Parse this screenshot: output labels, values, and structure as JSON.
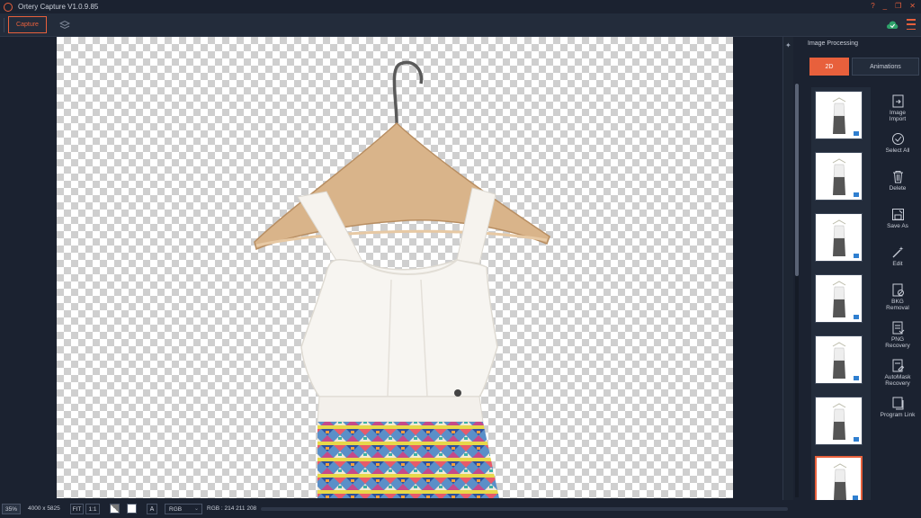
{
  "app": {
    "title": "Ortery Capture V1.0.9.85",
    "window_controls": [
      "?",
      "_",
      "❐",
      "✕"
    ]
  },
  "toolbar": {
    "capture_label": "Capture"
  },
  "panel": {
    "title": "Image Processing",
    "tabs": [
      {
        "label": "2D",
        "active": true
      },
      {
        "label": "Animations",
        "active": false
      }
    ],
    "thumbnails_count_visible": 7,
    "selected_thumbnail": 7,
    "tools": [
      {
        "label_line1": "Image",
        "label_line2": "Import",
        "icon": "image-import-icon"
      },
      {
        "label_line1": "Select All",
        "label_line2": "",
        "icon": "select-all-icon"
      },
      {
        "label_line1": "Delete",
        "label_line2": "",
        "icon": "trash-icon"
      },
      {
        "label_line1": "Save As",
        "label_line2": "",
        "icon": "save-as-icon"
      },
      {
        "label_line1": "Edit",
        "label_line2": "",
        "icon": "magic-wand-icon"
      },
      {
        "label_line1": "BKG",
        "label_line2": "Removal",
        "icon": "bkg-removal-icon"
      },
      {
        "label_line1": "PNG",
        "label_line2": "Recovery",
        "icon": "png-recovery-icon"
      },
      {
        "label_line1": "AutoMask",
        "label_line2": "Recovery",
        "icon": "automask-recovery-icon"
      },
      {
        "label_line1": "Program Link",
        "label_line2": "",
        "icon": "program-link-icon"
      }
    ]
  },
  "status": {
    "zoom": "35%",
    "dimensions": "4000 x 5825",
    "fit_label": "FIT",
    "one_to_one_label": "1:1",
    "text_tool_label": "A",
    "color_mode": "RGB",
    "rgb_readout": "RGB : 214 211 208"
  },
  "colors": {
    "accent": "#e8603c",
    "background": "#1b2230",
    "panel": "#232c3b"
  }
}
